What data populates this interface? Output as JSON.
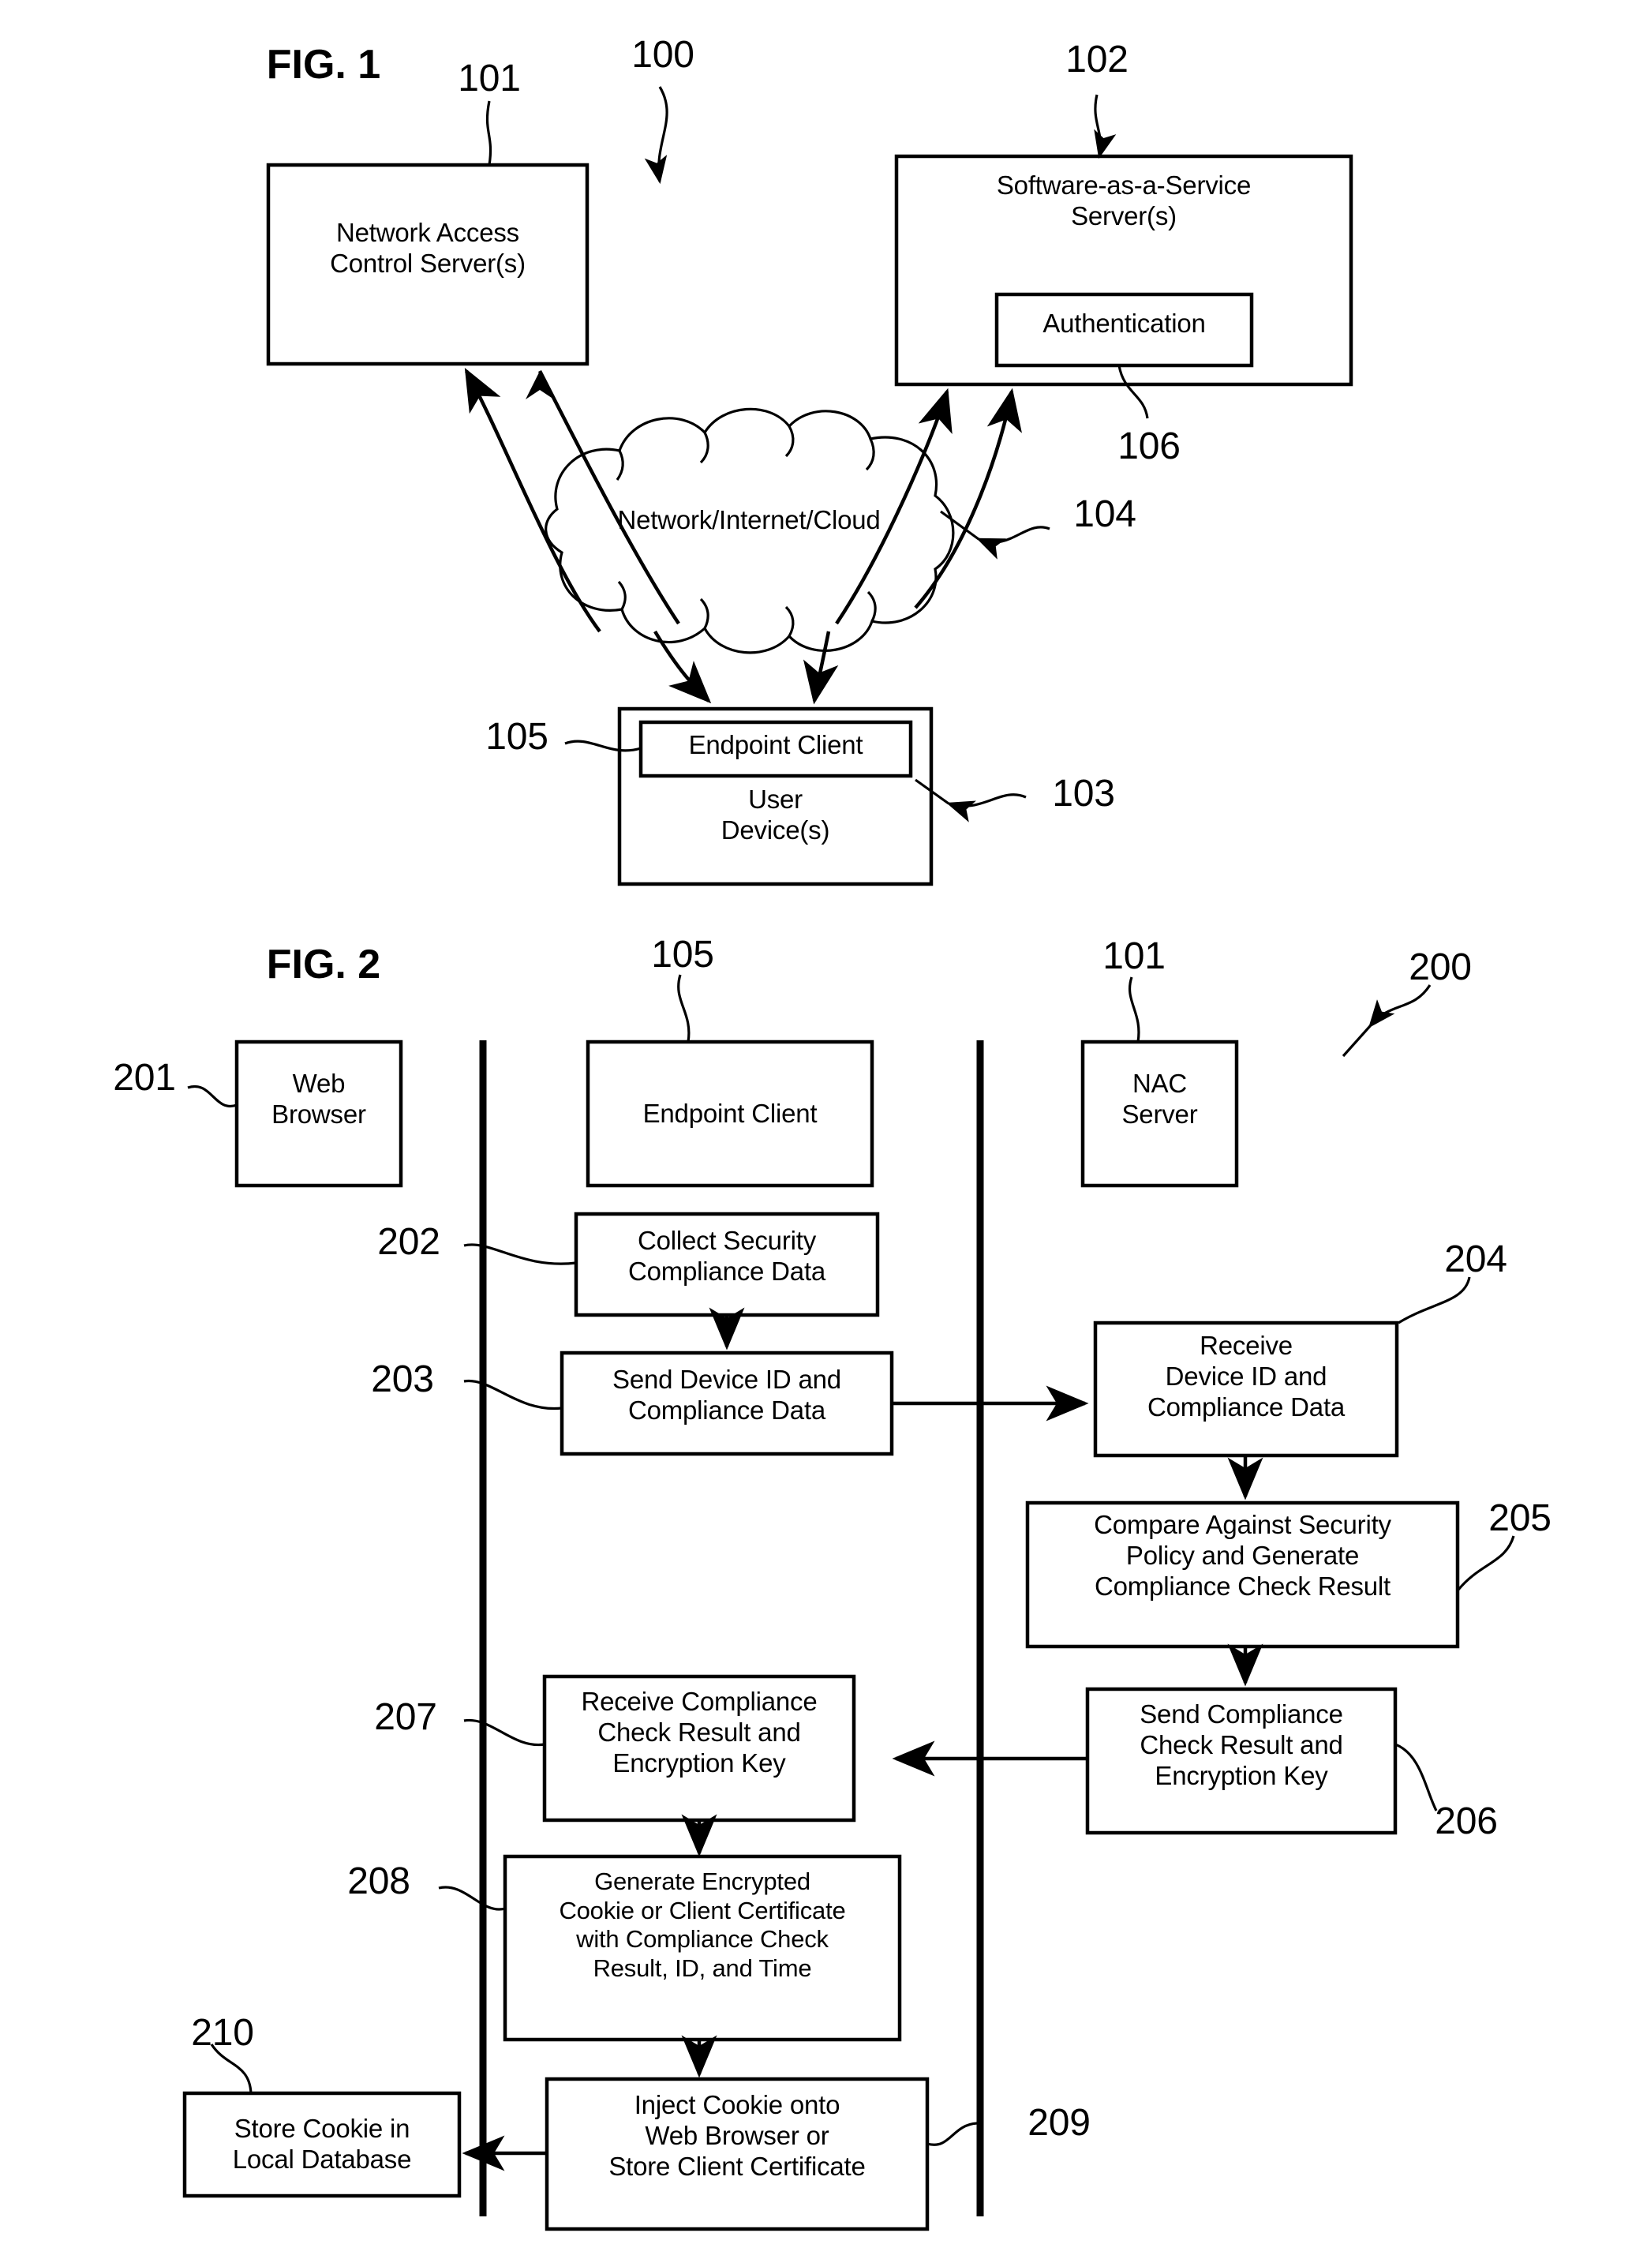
{
  "figure1": {
    "title": "FIG. 1",
    "system_ref": "100",
    "nodes": {
      "nac_server": {
        "label": "Network Access\nControl Server(s)",
        "ref": "101"
      },
      "saas_server": {
        "label": "Software-as-a-Service\nServer(s)",
        "ref": "102"
      },
      "authentication": {
        "label": "Authentication",
        "ref": "106"
      },
      "network_cloud": {
        "label": "Network/Internet/Cloud",
        "ref": "104"
      },
      "endpoint_client": {
        "label": "Endpoint Client",
        "ref": "105"
      },
      "user_device": {
        "label": "User\nDevice(s)",
        "ref": "103"
      }
    }
  },
  "figure2": {
    "title": "FIG. 2",
    "system_ref": "200",
    "actors": [
      {
        "label": "Web\nBrowser",
        "ref": "201"
      },
      {
        "label": "Endpoint Client",
        "ref": "105"
      },
      {
        "label": "NAC\nServer",
        "ref": "101"
      }
    ],
    "steps": [
      {
        "ref": "202",
        "label": "Collect Security\nCompliance Data"
      },
      {
        "ref": "203",
        "label": "Send Device ID and\nCompliance Data"
      },
      {
        "ref": "204",
        "label": "Receive\nDevice ID and\nCompliance Data"
      },
      {
        "ref": "205",
        "label": "Compare Against Security\nPolicy and Generate\nCompliance Check Result"
      },
      {
        "ref": "206",
        "label": "Send Compliance\nCheck Result and\nEncryption Key"
      },
      {
        "ref": "207",
        "label": "Receive Compliance\nCheck Result and\nEncryption Key"
      },
      {
        "ref": "208",
        "label": "Generate Encrypted\nCookie or Client Certificate\nwith Compliance Check\nResult, ID, and Time"
      },
      {
        "ref": "209",
        "label": "Inject Cookie onto\nWeb Browser or\nStore Client Certificate"
      },
      {
        "ref": "210",
        "label": "Store Cookie in\nLocal Database"
      }
    ]
  },
  "colors": {
    "ink": "#000000",
    "paper": "#ffffff"
  }
}
